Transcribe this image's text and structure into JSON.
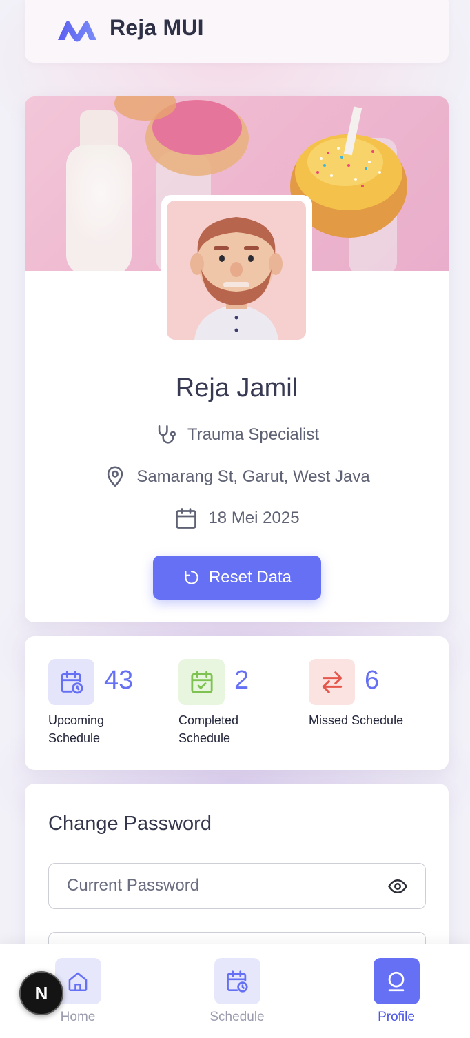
{
  "header": {
    "brand": "Reja MUI",
    "logo_icon": "mui-logo-icon"
  },
  "profile": {
    "name": "Reja Jamil",
    "specialty": "Trauma Specialist",
    "location": "Samarang St, Garut, West Java",
    "date": "18 Mei 2025",
    "reset_label": "Reset Data",
    "cover_image": "donuts-milk-photo",
    "avatar_image": "bearded-man-3d-avatar"
  },
  "stats": [
    {
      "value": "43",
      "label": "Upcoming Schedule",
      "icon": "calendar-clock-icon",
      "color": "#6570f4",
      "bg": "#e4e5fb"
    },
    {
      "value": "2",
      "label": "Completed Schedule",
      "icon": "calendar-check-icon",
      "color": "#7ec352",
      "bg": "#e9f6df"
    },
    {
      "value": "6",
      "label": "Missed Schedule",
      "icon": "arrows-exchange-icon",
      "color": "#e5574c",
      "bg": "#fbe3e1"
    }
  ],
  "password": {
    "title": "Change Password",
    "current_placeholder": "Current Password",
    "new_placeholder": ""
  },
  "nav": {
    "items": [
      {
        "label": "Home",
        "icon": "home-icon"
      },
      {
        "label": "Schedule",
        "icon": "calendar-clock-icon"
      },
      {
        "label": "Profile",
        "icon": "user-icon"
      }
    ],
    "active": "Profile"
  },
  "fab": {
    "label": "N"
  },
  "colors": {
    "primary": "#6570f4",
    "active_nav": "#4a55e6"
  }
}
